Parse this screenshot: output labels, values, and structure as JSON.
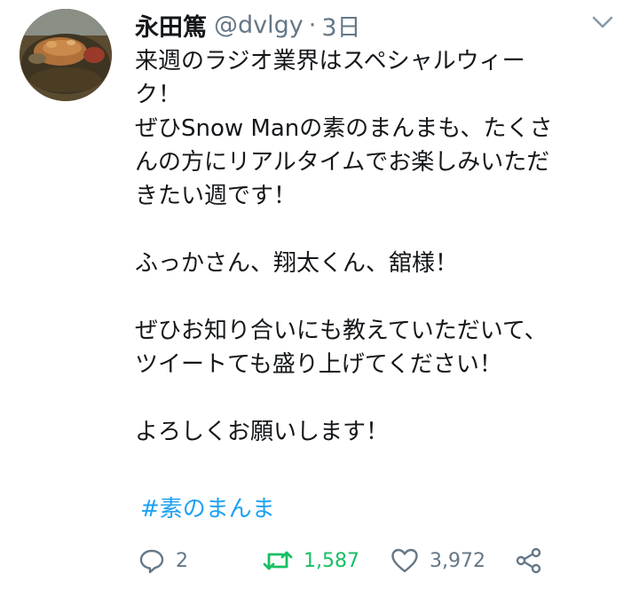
{
  "tweet": {
    "author": {
      "display_name": "永田篤",
      "handle": "@dvlgy",
      "separator": "·",
      "timestamp": "3日"
    },
    "body_lines": [
      "来週のラジオ業界はスペシャルウィー",
      "ク！",
      "ぜひSnow Manの素のまんまも、たくさ",
      "んの方にリアルタイムでお楽しみいただ",
      "きたい週です！",
      "",
      "ふっかさん、翔太くん、舘様！",
      "",
      "ぜひお知り合いにも教えていただいて、",
      "ツイートても盛り上げてください！",
      "",
      "よろしくお願いします！"
    ],
    "hashtag": "#素のまんま",
    "actions": {
      "reply_count": "2",
      "retweet_count": "1,587",
      "like_count": "3,972"
    }
  },
  "icons": {
    "reply": "reply-icon",
    "retweet": "retweet-icon",
    "like": "heart-icon",
    "share": "share-icon",
    "menu": "chevron-down-icon"
  },
  "colors": {
    "text": "#14171a",
    "secondary": "#657786",
    "link": "#1da1f2",
    "retweeted": "#17bf63"
  }
}
